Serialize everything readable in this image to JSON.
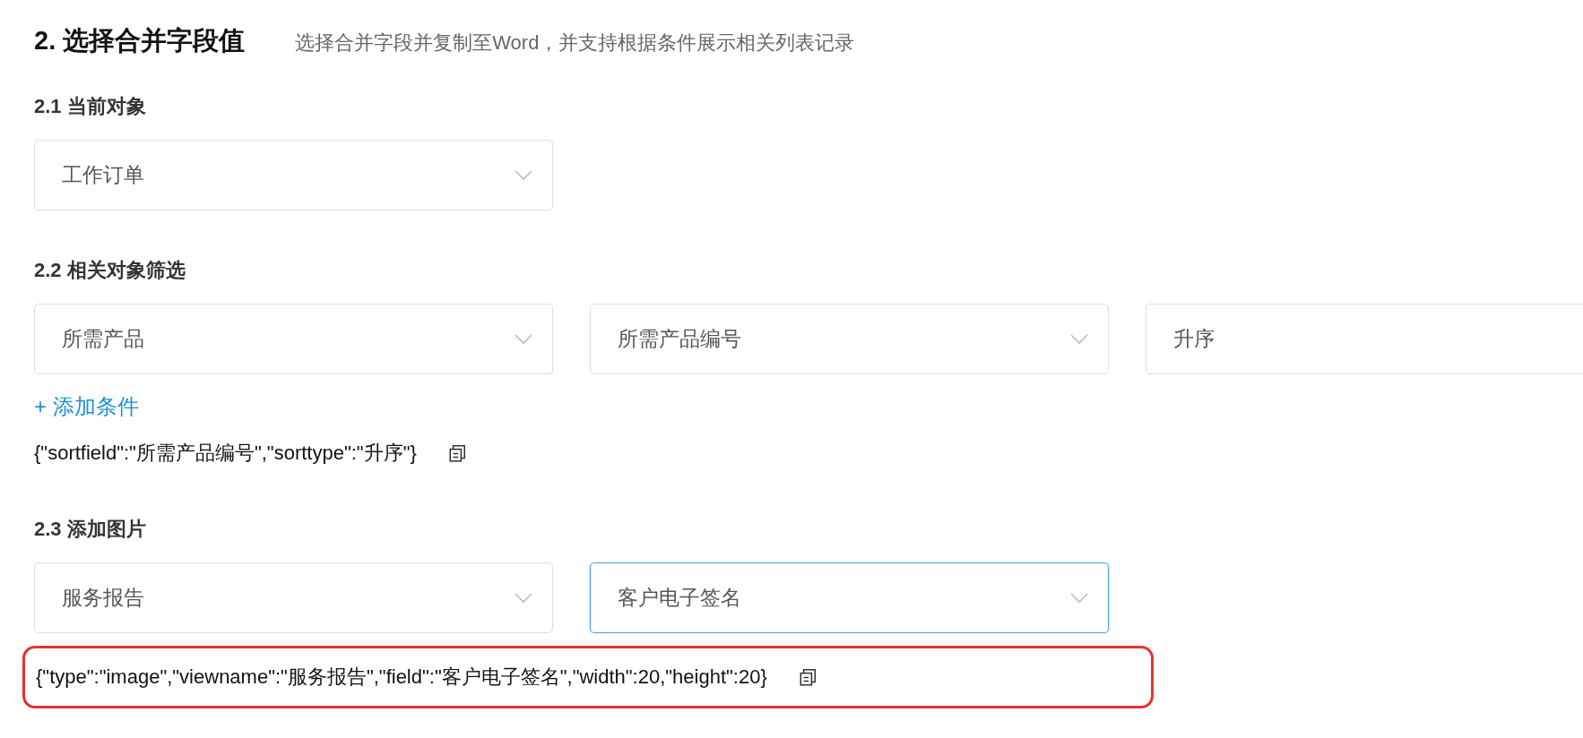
{
  "section": {
    "title": "2. 选择合并字段值",
    "subtitle": "选择合并字段并复制至Word，并支持根据条件展示相关列表记录"
  },
  "groups": [
    {
      "heading": "2.1 当前对象",
      "selects": [
        {
          "value": "工作订单",
          "focused": false,
          "chevron": true
        }
      ]
    },
    {
      "heading": "2.2 相关对象筛选",
      "selects": [
        {
          "value": "所需产品",
          "focused": false,
          "chevron": true
        },
        {
          "value": "所需产品编号",
          "focused": false,
          "chevron": true
        },
        {
          "value": "升序",
          "focused": false,
          "chevron": false
        }
      ],
      "add_link": "+ 添加条件",
      "code": {
        "text": "{\"sortfield\":\"所需产品编号\",\"sorttype\":\"升序\"}",
        "highlighted": false
      }
    },
    {
      "heading": "2.3 添加图片",
      "selects": [
        {
          "value": "服务报告",
          "focused": false,
          "chevron": true
        },
        {
          "value": "客户电子签名",
          "focused": true,
          "chevron": true
        }
      ],
      "code": {
        "text": "{\"type\":\"image\",\"viewname\":\"服务报告\",\"field\":\"客户电子签名\",\"width\":20,\"height\":20}",
        "highlighted": true
      }
    }
  ]
}
